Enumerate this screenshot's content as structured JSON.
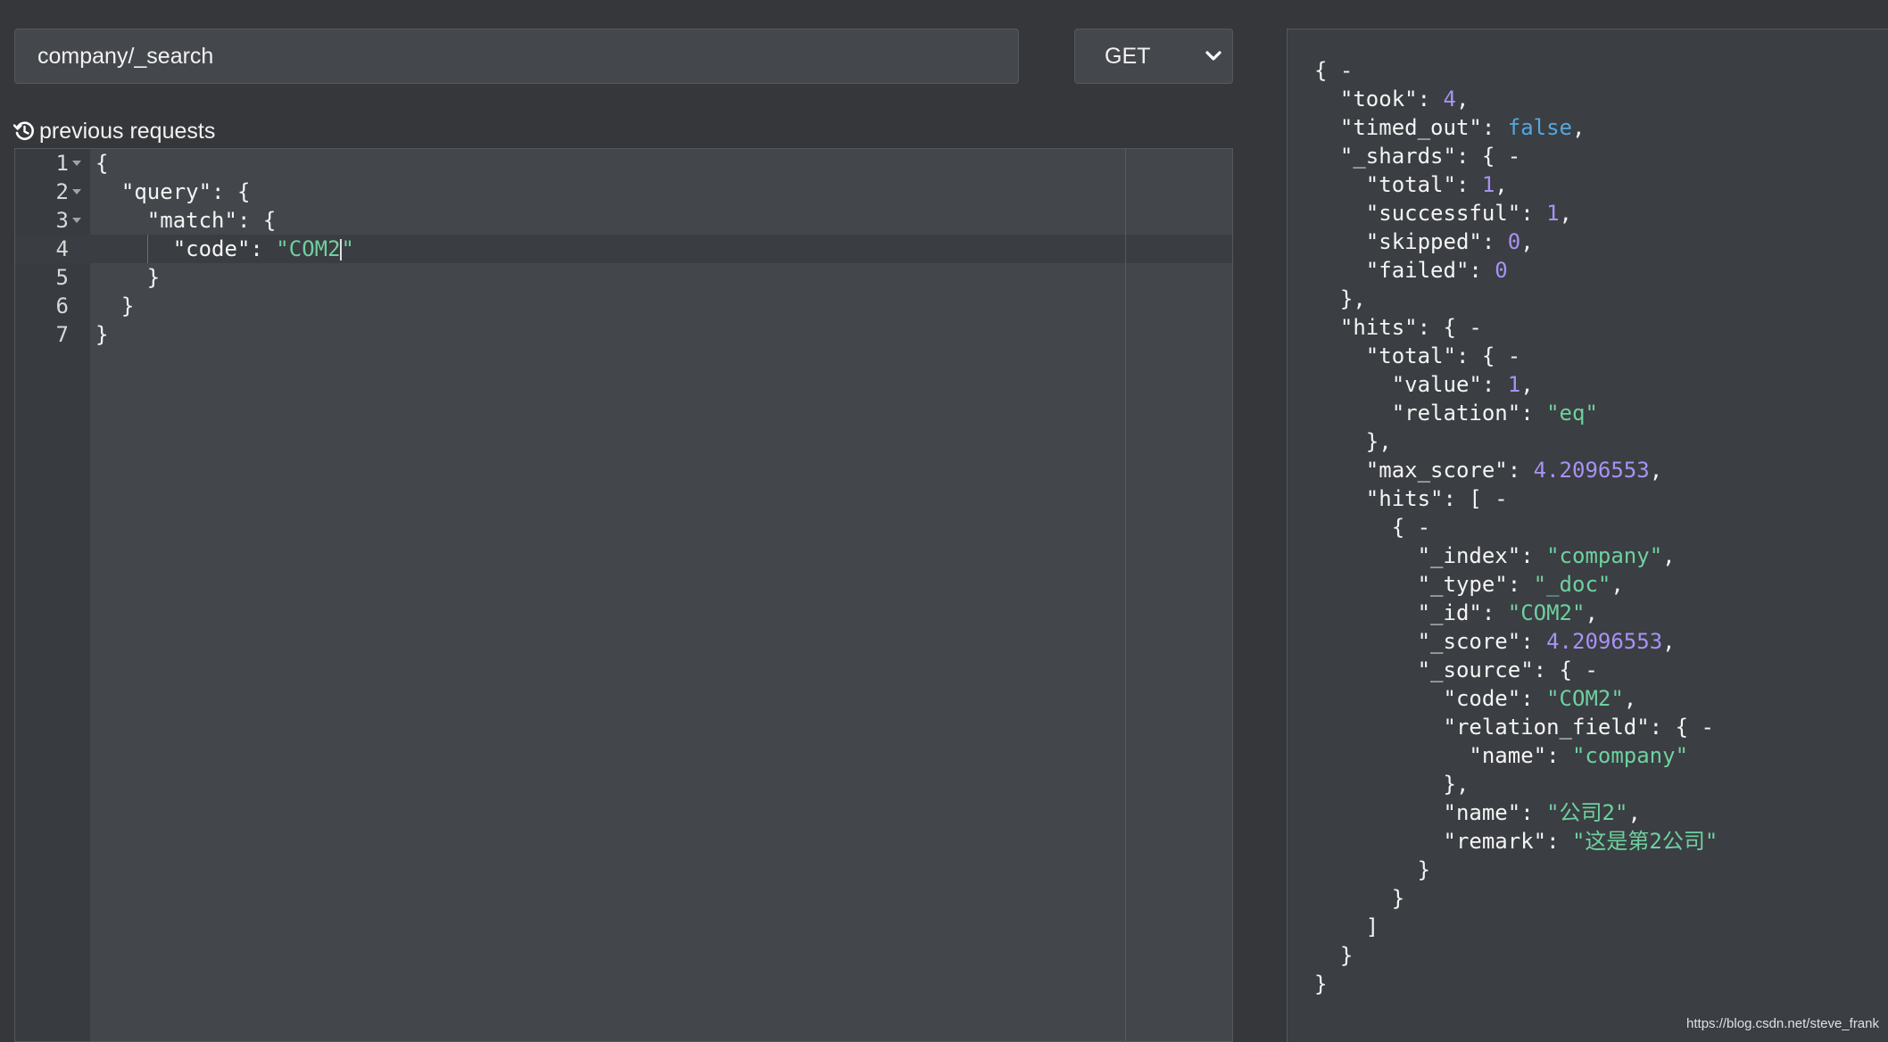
{
  "request": {
    "url": "company/_search",
    "method": "GET",
    "previous_requests_label": "previous requests"
  },
  "editor": {
    "lines": [
      {
        "num": "1",
        "fold": true,
        "parts": [
          {
            "t": "{",
            "c": ""
          }
        ]
      },
      {
        "num": "2",
        "fold": true,
        "parts": [
          {
            "t": "  \"query\": {",
            "c": ""
          }
        ]
      },
      {
        "num": "3",
        "fold": true,
        "parts": [
          {
            "t": "    \"match\": {",
            "c": ""
          }
        ]
      },
      {
        "num": "4",
        "fold": false,
        "parts": [
          {
            "t": "      \"code\": ",
            "c": ""
          },
          {
            "t": "\"COM2",
            "c": "str"
          },
          {
            "t": "|",
            "c": "cursor"
          },
          {
            "t": "\"",
            "c": "str"
          }
        ]
      },
      {
        "num": "5",
        "fold": false,
        "parts": [
          {
            "t": "    }",
            "c": ""
          }
        ]
      },
      {
        "num": "6",
        "fold": false,
        "parts": [
          {
            "t": "  }",
            "c": ""
          }
        ]
      },
      {
        "num": "7",
        "fold": false,
        "parts": [
          {
            "t": "}",
            "c": ""
          }
        ]
      }
    ]
  },
  "response": {
    "lines": [
      [
        {
          "t": "{ -",
          "c": ""
        }
      ],
      [
        {
          "t": "  \"took\": ",
          "c": ""
        },
        {
          "t": "4",
          "c": "num"
        },
        {
          "t": ",",
          "c": ""
        }
      ],
      [
        {
          "t": "  \"timed_out\": ",
          "c": ""
        },
        {
          "t": "false",
          "c": "bool"
        },
        {
          "t": ",",
          "c": ""
        }
      ],
      [
        {
          "t": "  \"_shards\": { -",
          "c": ""
        }
      ],
      [
        {
          "t": "    \"total\": ",
          "c": ""
        },
        {
          "t": "1",
          "c": "num"
        },
        {
          "t": ",",
          "c": ""
        }
      ],
      [
        {
          "t": "    \"successful\": ",
          "c": ""
        },
        {
          "t": "1",
          "c": "num"
        },
        {
          "t": ",",
          "c": ""
        }
      ],
      [
        {
          "t": "    \"skipped\": ",
          "c": ""
        },
        {
          "t": "0",
          "c": "num"
        },
        {
          "t": ",",
          "c": ""
        }
      ],
      [
        {
          "t": "    \"failed\": ",
          "c": ""
        },
        {
          "t": "0",
          "c": "num"
        }
      ],
      [
        {
          "t": "  },",
          "c": ""
        }
      ],
      [
        {
          "t": "  \"hits\": { -",
          "c": ""
        }
      ],
      [
        {
          "t": "    \"total\": { -",
          "c": ""
        }
      ],
      [
        {
          "t": "      \"value\": ",
          "c": ""
        },
        {
          "t": "1",
          "c": "num"
        },
        {
          "t": ",",
          "c": ""
        }
      ],
      [
        {
          "t": "      \"relation\": ",
          "c": ""
        },
        {
          "t": "\"eq\"",
          "c": "rstr"
        }
      ],
      [
        {
          "t": "    },",
          "c": ""
        }
      ],
      [
        {
          "t": "    \"max_score\": ",
          "c": ""
        },
        {
          "t": "4.2096553",
          "c": "num"
        },
        {
          "t": ",",
          "c": ""
        }
      ],
      [
        {
          "t": "    \"hits\": [ -",
          "c": ""
        }
      ],
      [
        {
          "t": "      { -",
          "c": ""
        }
      ],
      [
        {
          "t": "        \"_index\": ",
          "c": ""
        },
        {
          "t": "\"company\"",
          "c": "rstr"
        },
        {
          "t": ",",
          "c": ""
        }
      ],
      [
        {
          "t": "        \"_type\": ",
          "c": ""
        },
        {
          "t": "\"_doc\"",
          "c": "rstr"
        },
        {
          "t": ",",
          "c": ""
        }
      ],
      [
        {
          "t": "        \"_id\": ",
          "c": ""
        },
        {
          "t": "\"COM2\"",
          "c": "rstr"
        },
        {
          "t": ",",
          "c": ""
        }
      ],
      [
        {
          "t": "        \"_score\": ",
          "c": ""
        },
        {
          "t": "4.2096553",
          "c": "num"
        },
        {
          "t": ",",
          "c": ""
        }
      ],
      [
        {
          "t": "        \"_source\": { -",
          "c": ""
        }
      ],
      [
        {
          "t": "          \"code\": ",
          "c": ""
        },
        {
          "t": "\"COM2\"",
          "c": "rstr"
        },
        {
          "t": ",",
          "c": ""
        }
      ],
      [
        {
          "t": "          \"relation_field\": { -",
          "c": ""
        }
      ],
      [
        {
          "t": "            \"name\": ",
          "c": ""
        },
        {
          "t": "\"company\"",
          "c": "rstr"
        }
      ],
      [
        {
          "t": "          },",
          "c": ""
        }
      ],
      [
        {
          "t": "          \"name\": ",
          "c": ""
        },
        {
          "t": "\"公司2\"",
          "c": "rstr"
        },
        {
          "t": ",",
          "c": ""
        }
      ],
      [
        {
          "t": "          \"remark\": ",
          "c": ""
        },
        {
          "t": "\"这是第2公司\"",
          "c": "rstr"
        }
      ],
      [
        {
          "t": "        }",
          "c": ""
        }
      ],
      [
        {
          "t": "      }",
          "c": ""
        }
      ],
      [
        {
          "t": "    ]",
          "c": ""
        }
      ],
      [
        {
          "t": "  }",
          "c": ""
        }
      ],
      [
        {
          "t": "}",
          "c": ""
        }
      ]
    ]
  },
  "watermark": "https://blog.csdn.net/steve_frank",
  "colors": {
    "background": "#35373a",
    "string": "#6fd0a0",
    "number": "#a792f5",
    "boolean": "#53a8e0"
  },
  "icons": {
    "method_dropdown": "chevron-down-icon",
    "previous_requests": "history-icon"
  }
}
